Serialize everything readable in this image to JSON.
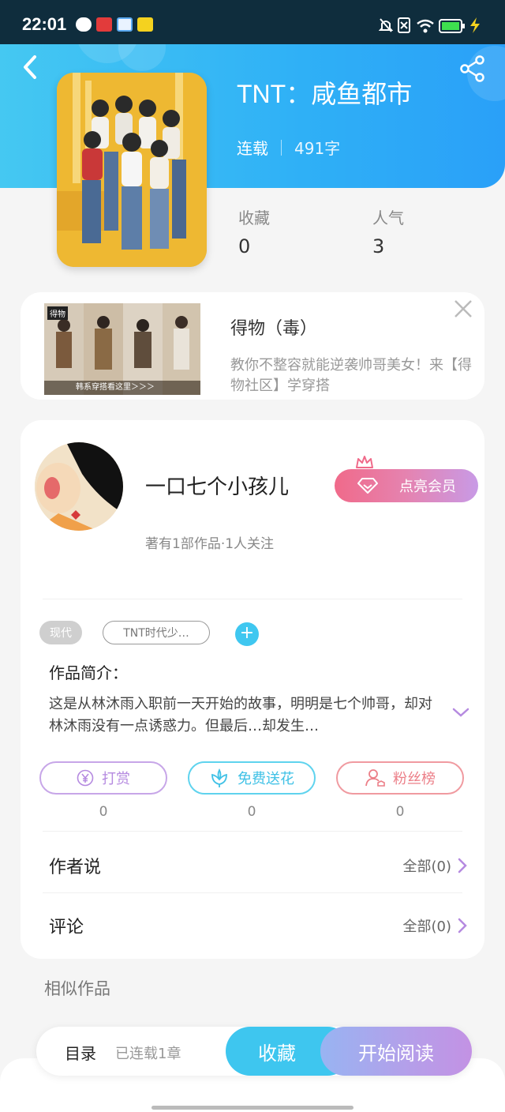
{
  "status_bar": {
    "time": "22:01"
  },
  "book": {
    "title": "TNT：咸鱼都市",
    "status": "连载",
    "word_count": "491字",
    "stats": [
      {
        "label": "收藏",
        "value": "0"
      },
      {
        "label": "人气",
        "value": "3"
      }
    ]
  },
  "ad": {
    "title": "得物（毒）",
    "description": "教你不整容就能逆袭帅哥美女！来【得物社区】学穿搭",
    "image_brand": "得物",
    "image_caption": "韩系穿搭看这里＞＞＞"
  },
  "author": {
    "name": "一口七个小孩儿",
    "meta": "著有1部作品·1人关注",
    "vip_label": "点亮会员"
  },
  "tags": {
    "genre": "现代",
    "topic": "TNT时代少…",
    "add": "+"
  },
  "intro": {
    "label": "作品简介：",
    "text": "这是从林沐雨入职前一天开始的故事，明明是七个帅哥，却对林沐雨没有一点诱惑力。但最后…却发生…"
  },
  "actions": [
    {
      "label": "打赏",
      "count": "0"
    },
    {
      "label": "免费送花",
      "count": "0"
    },
    {
      "label": "粉丝榜",
      "count": "0"
    }
  ],
  "rows": {
    "author_says": {
      "label": "作者说",
      "right": "全部(0)"
    },
    "comments": {
      "label": "评论",
      "right": "全部(0)"
    }
  },
  "similar_label": "相似作品",
  "bottom_bar": {
    "toc_label": "目录",
    "toc_status": "已连载1章",
    "favorite_label": "收藏",
    "read_label": "开始阅读"
  },
  "colors": {
    "accent_blue": "#3ec6ef",
    "vip_pink": "#f06a8a",
    "read_purple": "#b59ee9"
  }
}
